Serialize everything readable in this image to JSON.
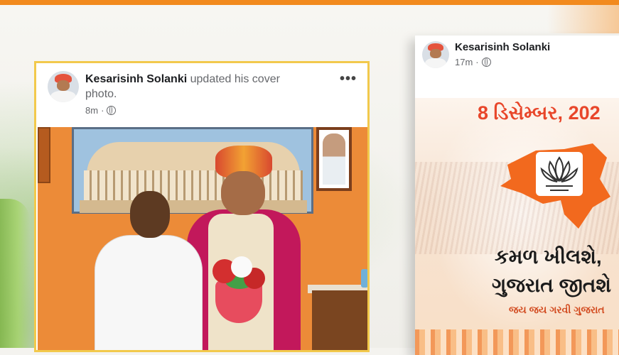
{
  "post1": {
    "author": "Kesarisinh Solanki",
    "action": " updated his cover photo.",
    "time": "8m",
    "separator": "·",
    "more_icon": "more-horizontal-icon",
    "privacy_icon": "globe-icon"
  },
  "post2": {
    "author": "Kesarisinh Solanki",
    "time": "17m",
    "separator": "·",
    "privacy_icon": "globe-icon",
    "poster": {
      "date_text": "8 ડિસેમ્બર, 202",
      "tagline_1": "કમળ ખીલશે,",
      "tagline_2": "ગુજરાત જીતશે",
      "tagline_3": "જય જય ગરવી ગુજરાત"
    }
  },
  "colors": {
    "accent_orange": "#f28a1e",
    "highlight_border": "#f2c94c",
    "poster_red": "#e8462a"
  }
}
